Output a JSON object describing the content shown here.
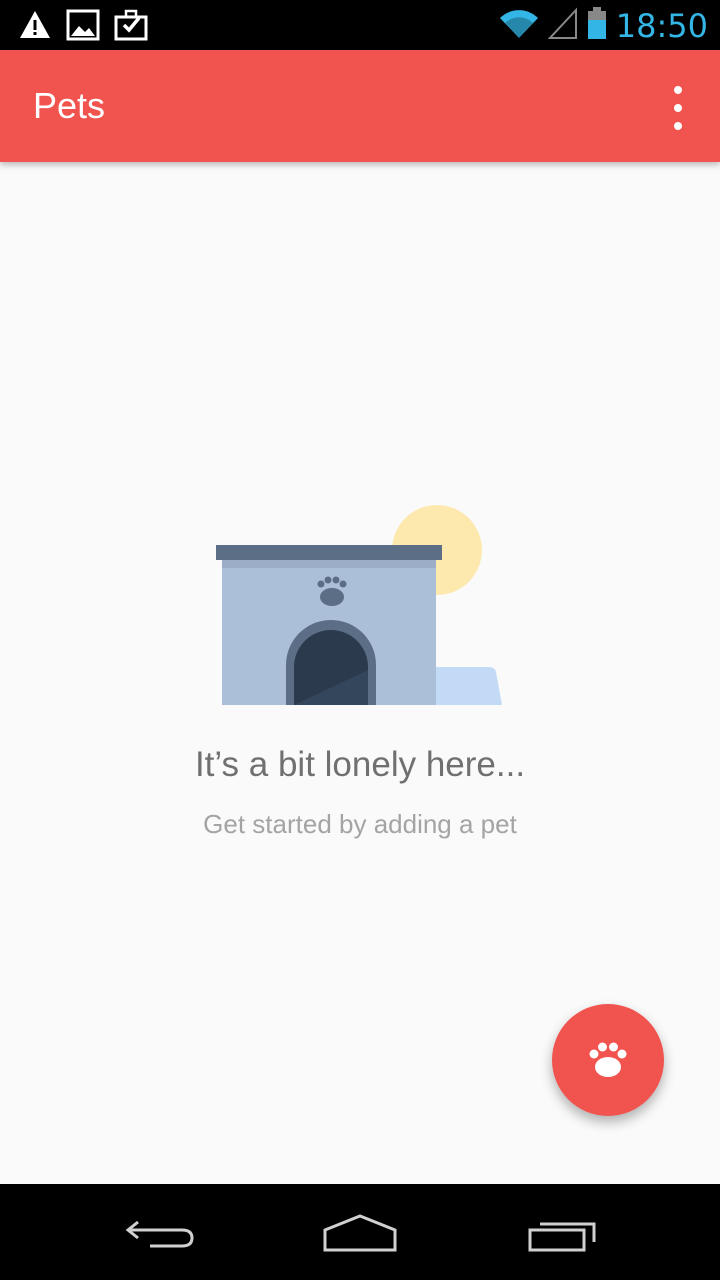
{
  "status_bar": {
    "time": "18:50",
    "icons": [
      "warning-icon",
      "image-icon",
      "briefcase-check-icon",
      "wifi-icon",
      "signal-icon",
      "battery-icon"
    ]
  },
  "app_bar": {
    "title": "Pets",
    "menu_icon": "overflow-menu-icon"
  },
  "empty_state": {
    "title": "It’s a bit lonely here...",
    "subtitle": "Get started by adding a pet",
    "illustration_icon": "doghouse-icon"
  },
  "fab": {
    "icon": "paw-icon"
  },
  "nav_bar": {
    "icons": [
      "back-icon",
      "home-icon",
      "recents-icon"
    ]
  },
  "colors": {
    "primary": "#f1534e",
    "background": "#fafafa",
    "status_accent": "#33b5e5",
    "title_text": "#707070",
    "subtitle_text": "#a4a4a4"
  }
}
